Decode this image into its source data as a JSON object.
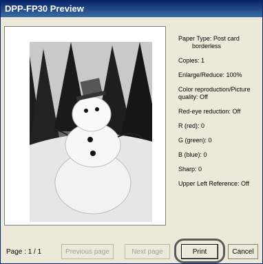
{
  "window": {
    "title": "DPP-FP30 Preview"
  },
  "info": {
    "paper_type": "Paper Type: Post card",
    "paper_type_sub": "borderless",
    "copies": "Copies: 1",
    "enlarge": "Enlarge/Reduce: 100%",
    "color_repro": "Color reproduction/Picture quality: Off",
    "redeye": "Red-eye reduction: Off",
    "r": "R (red): 0",
    "g": "G (green): 0",
    "b": "B (blue): 0",
    "sharp": "Sharp: 0",
    "upper_left": "Upper Left Reference: Off"
  },
  "footer": {
    "page": "Page : 1 / 1",
    "prev": "Previous page",
    "next": "Next page",
    "print": "Print",
    "cancel": "Cancel"
  }
}
